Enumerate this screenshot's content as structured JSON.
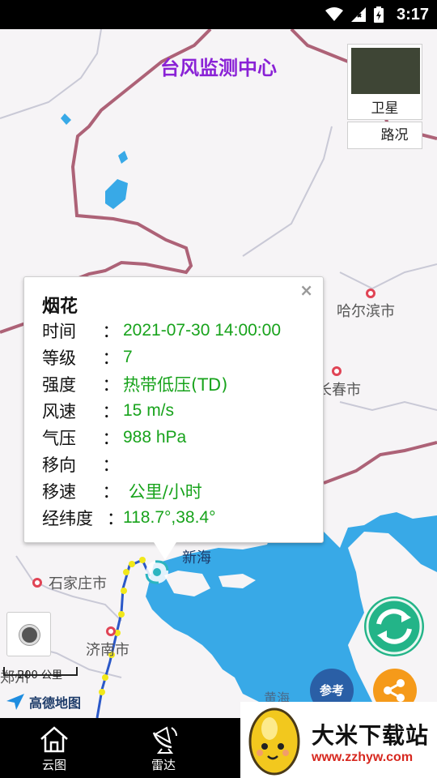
{
  "status_bar": {
    "time": "3:17"
  },
  "app": {
    "title": "台风监测中心"
  },
  "layers": {
    "satellite": "卫星",
    "traffic": "路况"
  },
  "popup": {
    "name": "烟花",
    "close": "×",
    "rows": [
      {
        "key": "时间",
        "value": "2021-07-30 14:00:00"
      },
      {
        "key": "等级",
        "value": "7"
      },
      {
        "key": "强度",
        "value": "热带低压(TD)"
      },
      {
        "key": "风速",
        "value": "15 m/s"
      },
      {
        "key": "气压",
        "value": "988 hPa"
      },
      {
        "key": "移向",
        "value": ""
      },
      {
        "key": "移速",
        "value": " 公里/小时"
      },
      {
        "key": "经纬度",
        "value": "118.7°,38.4°"
      }
    ],
    "colon": "："
  },
  "map": {
    "cities": {
      "harbin": "哈尔滨市",
      "changchun": "长春市",
      "shijiazhuang": "石家庄市",
      "jinan": "济南市",
      "zhengzhou": "郑州",
      "tianjin_partial": "新海"
    },
    "sea": {
      "huanghai": "黄海"
    },
    "scale": "200 公里",
    "brand": "高德地图"
  },
  "controls": {
    "reference": "参考"
  },
  "nav": {
    "items": [
      {
        "label": "云图"
      },
      {
        "label": "雷达"
      }
    ]
  },
  "watermark": {
    "name": "大米下载站",
    "url": "www.zzhyw.com"
  },
  "colors": {
    "accent_title": "#8a22d6",
    "value_green": "#18a31c",
    "refresh": "#23b488",
    "share": "#f59a1a",
    "reference": "#2a5fa6",
    "sea": "#38a9e7"
  }
}
